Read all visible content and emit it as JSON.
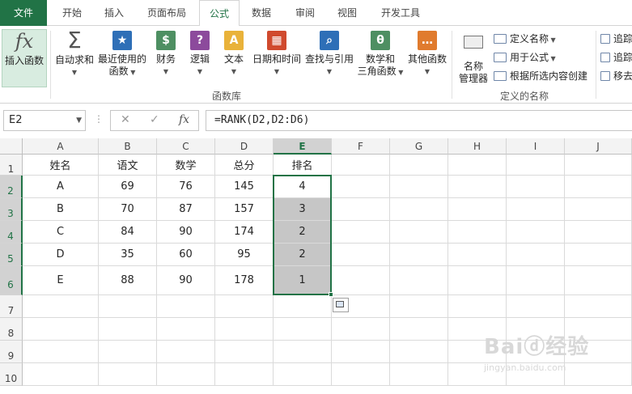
{
  "tabs": {
    "file": "文件",
    "home": "开始",
    "insert": "插入",
    "layout": "页面布局",
    "formulas": "公式",
    "data": "数据",
    "review": "审阅",
    "view": "视图",
    "dev": "开发工具"
  },
  "ribbon": {
    "insert_fn": "插入函数",
    "fx": "fx",
    "autosum": "自动求和",
    "recent": "最近使用的",
    "recent2": "函数",
    "finance": "财务",
    "logic": "逻辑",
    "text": "文本",
    "datetime": "日期和时间",
    "lookup": "查找与引用",
    "math": "数学和",
    "math2": "三角函数",
    "other": "其他函数",
    "lib_label": "函数库",
    "name_mgr": "名称",
    "name_mgr2": "管理器",
    "define_name": "定义名称",
    "use_in_formula": "用于公式",
    "create_from_sel": "根据所选内容创建",
    "names_label": "定义的名称",
    "trace1": "追踪",
    "trace2": "追踪",
    "remove": "移去"
  },
  "formula_bar": {
    "name_box": "E2",
    "cancel": "✕",
    "enter": "✓",
    "fx": "fx",
    "formula": "=RANK(D2,D2:D6)"
  },
  "columns": [
    "A",
    "B",
    "C",
    "D",
    "E",
    "F",
    "G",
    "H",
    "I",
    "J"
  ],
  "rows": [
    "1",
    "2",
    "3",
    "4",
    "5",
    "6",
    "7",
    "8",
    "9",
    "10"
  ],
  "table": [
    [
      "姓名",
      "语文",
      "数学",
      "总分",
      "排名"
    ],
    [
      "A",
      "69",
      "76",
      "145",
      "4"
    ],
    [
      "B",
      "70",
      "87",
      "157",
      "3"
    ],
    [
      "C",
      "84",
      "90",
      "174",
      "2"
    ],
    [
      "D",
      "35",
      "60",
      "95",
      "2"
    ],
    [
      "E",
      "88",
      "90",
      "178",
      "1"
    ]
  ],
  "watermark": "Baiⓓ经验",
  "watermark2": "jingyan.baidu.com",
  "colors": {
    "accent": "#217346",
    "selection": "#c6c6c6"
  }
}
